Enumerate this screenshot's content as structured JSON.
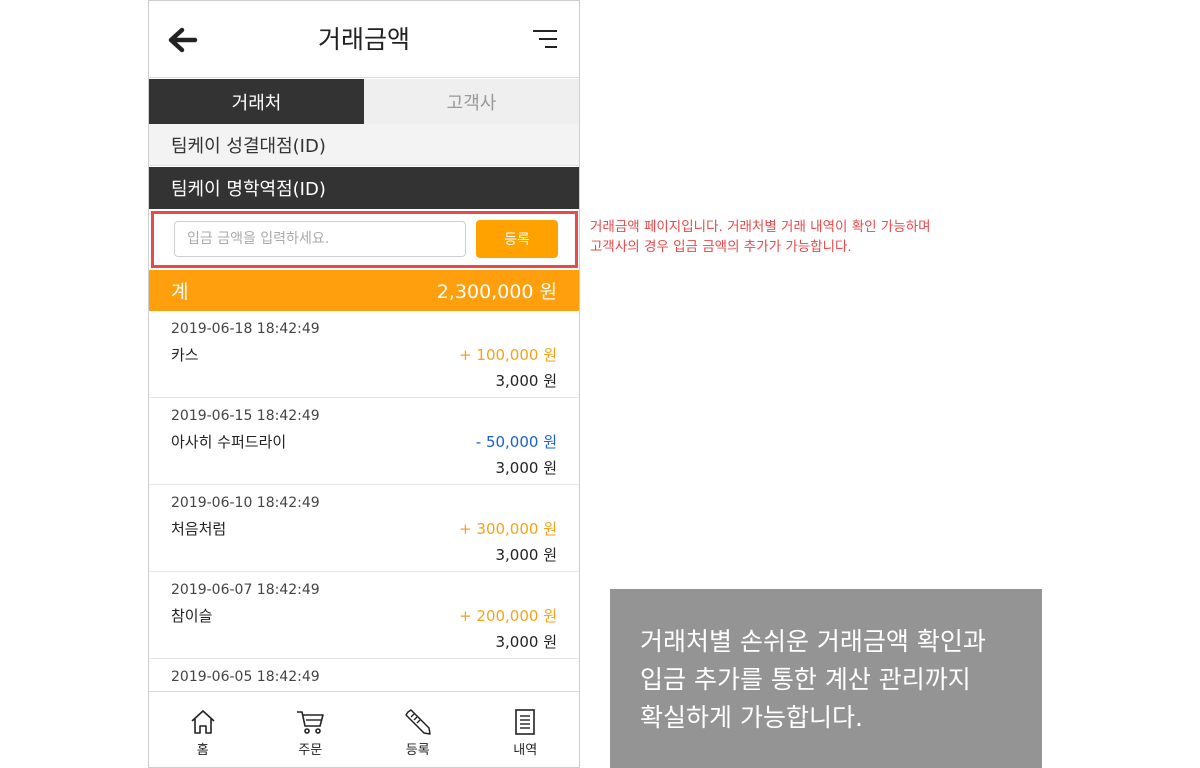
{
  "header": {
    "title": "거래금액",
    "back_icon": "arrow-left-icon",
    "menu_icon": "menu-icon"
  },
  "tabs": [
    {
      "label": "거래처",
      "active": true
    },
    {
      "label": "고객사",
      "active": false
    }
  ],
  "stores": [
    {
      "label": "팀케이 성결대점(ID)",
      "selected": false
    },
    {
      "label": "팀케이 명학역점(ID)",
      "selected": true
    }
  ],
  "deposit": {
    "placeholder": "입금 금액을 입력하세요.",
    "value": "",
    "button_label": "등록"
  },
  "total": {
    "label": "계",
    "amount": "2,300,000 원"
  },
  "transactions": [
    {
      "date": "2019-06-18 18:42:49",
      "name": "카스",
      "amount": "+ 100,000 원",
      "type": "plus",
      "balance": "3,000 원"
    },
    {
      "date": "2019-06-15 18:42:49",
      "name": "아사히 수퍼드라이",
      "amount": "- 50,000 원",
      "type": "minus",
      "balance": "3,000 원"
    },
    {
      "date": "2019-06-10 18:42:49",
      "name": "처음처럼",
      "amount": "+ 300,000 원",
      "type": "plus",
      "balance": "3,000 원"
    },
    {
      "date": "2019-06-07 18:42:49",
      "name": "참이슬",
      "amount": "+ 200,000 원",
      "type": "plus",
      "balance": "3,000 원"
    },
    {
      "date": "2019-06-05 18:42:49",
      "name": "",
      "amount": "",
      "type": "plus",
      "balance": ""
    }
  ],
  "bottom_nav": [
    {
      "label": "홈",
      "icon": "home-icon"
    },
    {
      "label": "주문",
      "icon": "cart-icon"
    },
    {
      "label": "등록",
      "icon": "pencil-icon"
    },
    {
      "label": "내역",
      "icon": "document-icon"
    }
  ],
  "annotation": {
    "line1": "거래금액 페이지입니다. 거래처별 거래 내역이 확인 가능하며",
    "line2": "고객사의 경우 입금 금액의 추가가 가능합니다."
  },
  "feature": {
    "line1": "거래처별 손쉬운 거래금액 확인과",
    "line2": "입금 추가를 통한 계산 관리까지",
    "line3": "확실하게 가능합니다."
  },
  "colors": {
    "accent": "#ff9f0e",
    "dark": "#333333",
    "plus": "#f7a21b",
    "minus": "#1a5fd6",
    "highlight": "#e8494a"
  }
}
